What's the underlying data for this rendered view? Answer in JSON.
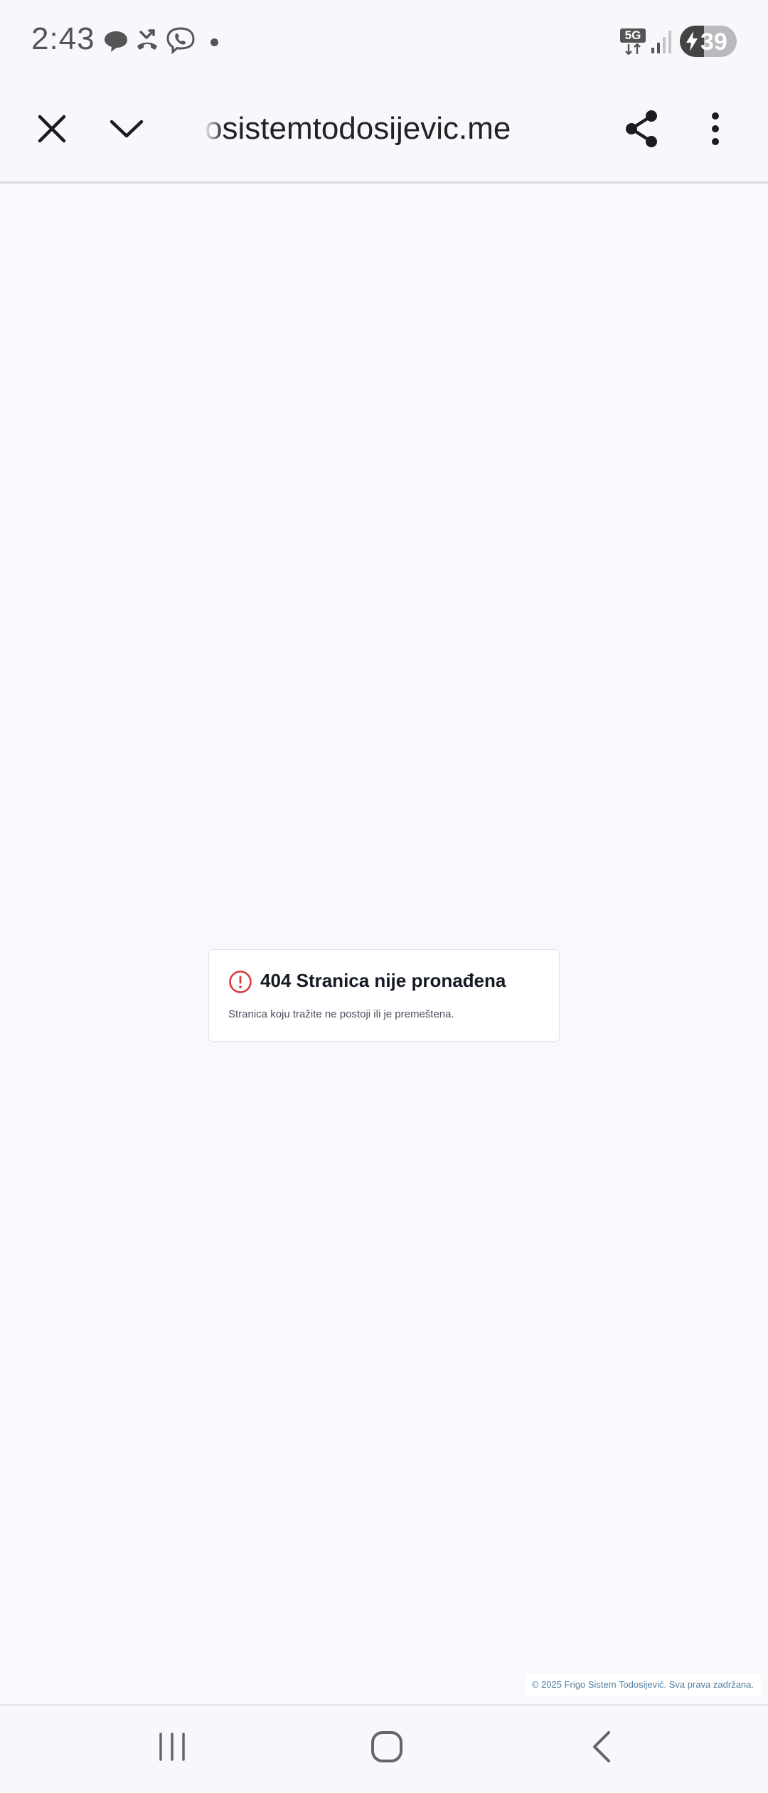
{
  "status_bar": {
    "time": "2:43",
    "network": "5G",
    "battery_percent": "39",
    "icons": [
      "chat-bubble-icon",
      "missed-call-icon",
      "viber-icon",
      "notification-dot-icon",
      "5g-icon",
      "signal-icon",
      "battery-charging-icon"
    ]
  },
  "toolbar": {
    "url": "osistemtodosijevic.me",
    "close_icon": "close-icon",
    "minimize_icon": "chevron-down-icon",
    "share_icon": "share-icon",
    "menu_icon": "more-vert-icon"
  },
  "error": {
    "title": "404 Stranica nije pronađena",
    "description": "Stranica koju tražite ne postoji ili je premeštena.",
    "icon": "alert-circle-icon",
    "icon_color": "#d93b3b"
  },
  "footer": {
    "copyright": "© 2025 Frigo Sistem Todosijević. Sva prava zadržana."
  },
  "nav_bar": {
    "icons": [
      "recents-icon",
      "home-icon",
      "back-icon"
    ]
  }
}
